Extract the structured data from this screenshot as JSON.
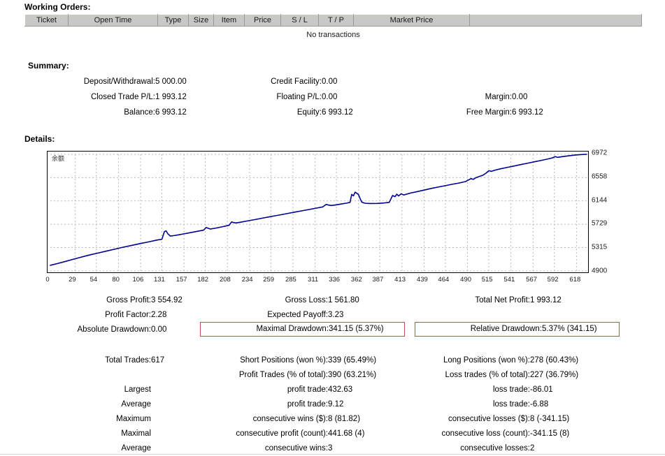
{
  "working_orders": {
    "title": "Working Orders:",
    "columns": [
      "Ticket",
      "Open Time",
      "Type",
      "Size",
      "Item",
      "Price",
      "S / L",
      "T / P",
      "Market Price",
      ""
    ],
    "empty_message": "No transactions"
  },
  "summary": {
    "title": "Summary:",
    "rows": [
      {
        "c1_label": "Deposit/Withdrawal:",
        "c1_value": "5 000.00",
        "c2_label": "Credit Facility:",
        "c2_value": "0.00",
        "c3_label": "",
        "c3_value": ""
      },
      {
        "c1_label": "Closed Trade P/L:",
        "c1_value": "1 993.12",
        "c2_label": "Floating P/L:",
        "c2_value": "0.00",
        "c3_label": "Margin:",
        "c3_value": "0.00"
      },
      {
        "c1_label": "Balance:",
        "c1_value": "6 993.12",
        "c2_label": "Equity:",
        "c2_value": "6 993.12",
        "c3_label": "Free Margin:",
        "c3_value": "6 993.12"
      }
    ]
  },
  "details": {
    "title": "Details:"
  },
  "stats_block_a": {
    "rows": [
      {
        "c1_label": "Gross Profit:",
        "c1_value": "3 554.92",
        "c2_label": "Gross Loss:",
        "c2_value": "1 561.80",
        "c3_label": "Total Net Profit:",
        "c3_value": "1 993.12",
        "c2_boxed": false,
        "c3_boxed": false
      },
      {
        "c1_label": "Profit Factor:",
        "c1_value": "2.28",
        "c2_label": "Expected Payoff:",
        "c2_value": "3.23",
        "c3_label": "",
        "c3_value": "",
        "c2_boxed": false,
        "c3_boxed": false
      },
      {
        "c1_label": "Absolute Drawdown:",
        "c1_value": "0.00",
        "c2_label": "Maximal Drawdown:",
        "c2_value": "341.15 (5.37%)",
        "c3_label": "Relative Drawdown:",
        "c3_value": "5.37% (341.15)",
        "c2_boxed": true,
        "c3_boxed": true
      }
    ]
  },
  "stats_block_b": {
    "rows": [
      {
        "c1_label": "Total Trades:",
        "c1_value": "617",
        "c2_label": "Short Positions (won %):",
        "c2_value": "339 (65.49%)",
        "c3_label": "Long Positions (won %):",
        "c3_value": "278 (60.43%)"
      },
      {
        "c1_label": "",
        "c1_value": "",
        "c2_label": "Profit Trades (% of total):",
        "c2_value": "390 (63.21%)",
        "c3_label": "Loss trades (% of total):",
        "c3_value": "227 (36.79%)"
      },
      {
        "c1_label": "Largest",
        "c1_value": "",
        "c2_label": "profit trade:",
        "c2_value": "432.63",
        "c3_label": "loss trade:",
        "c3_value": "-86.01"
      },
      {
        "c1_label": "Average",
        "c1_value": "",
        "c2_label": "profit trade:",
        "c2_value": "9.12",
        "c3_label": "loss trade:",
        "c3_value": "-6.88"
      },
      {
        "c1_label": "Maximum",
        "c1_value": "",
        "c2_label": "consecutive wins ($):",
        "c2_value": "8 (81.82)",
        "c3_label": "consecutive losses ($):",
        "c3_value": "8 (-341.15)"
      },
      {
        "c1_label": "Maximal",
        "c1_value": "",
        "c2_label": "consecutive profit (count):",
        "c2_value": "441.68 (4)",
        "c3_label": "consecutive loss (count):",
        "c3_value": "-341.15 (8)"
      },
      {
        "c1_label": "Average",
        "c1_value": "",
        "c2_label": "consecutive wins:",
        "c2_value": "3",
        "c3_label": "consecutive losses:",
        "c3_value": "2"
      }
    ]
  },
  "chart_data": {
    "type": "line",
    "title": "",
    "legend": "余额",
    "legend_position": "top-left",
    "line_color": "#00008f",
    "grid": true,
    "xlabel": "",
    "ylabel": "",
    "xlim": [
      0,
      630
    ],
    "ylim": [
      4900,
      6972
    ],
    "x_ticks": [
      0,
      29,
      54,
      80,
      106,
      131,
      157,
      182,
      208,
      234,
      259,
      285,
      311,
      336,
      362,
      387,
      413,
      439,
      464,
      490,
      515,
      541,
      567,
      592,
      618
    ],
    "y_ticks": [
      4900,
      5315,
      5729,
      6144,
      6558,
      6972
    ],
    "series": [
      {
        "name": "余额",
        "x": [
          0,
          8,
          16,
          25,
          35,
          45,
          55,
          65,
          75,
          85,
          95,
          105,
          115,
          125,
          131,
          134,
          136,
          138,
          141,
          145,
          150,
          158,
          166,
          174,
          180,
          183,
          185,
          188,
          194,
          202,
          210,
          213,
          215,
          218,
          224,
          232,
          240,
          248,
          256,
          264,
          272,
          280,
          288,
          296,
          304,
          312,
          320,
          324,
          327,
          330,
          336,
          342,
          348,
          352,
          354,
          356,
          358,
          360,
          362,
          364,
          366,
          370,
          376,
          384,
          392,
          398,
          402,
          405,
          407,
          409,
          412,
          415,
          418,
          421,
          424,
          428,
          434,
          440,
          448,
          456,
          464,
          472,
          480,
          488,
          494,
          497,
          500,
          504,
          508,
          512,
          515,
          518,
          522,
          528,
          536,
          544,
          552,
          560,
          568,
          576,
          584,
          590,
          593,
          596,
          602,
          610,
          618,
          626,
          630
        ],
        "y": [
          5000,
          5030,
          5062,
          5100,
          5140,
          5180,
          5215,
          5250,
          5285,
          5320,
          5352,
          5385,
          5415,
          5448,
          5462,
          5600,
          5612,
          5560,
          5520,
          5528,
          5540,
          5562,
          5585,
          5608,
          5625,
          5672,
          5660,
          5645,
          5660,
          5685,
          5712,
          5772,
          5760,
          5752,
          5768,
          5790,
          5812,
          5835,
          5858,
          5880,
          5902,
          5925,
          5948,
          5970,
          5992,
          6015,
          6038,
          6082,
          6070,
          6062,
          6075,
          6090,
          6105,
          6118,
          6260,
          6235,
          6300,
          6280,
          6255,
          6180,
          6120,
          6102,
          6098,
          6100,
          6108,
          6118,
          6240,
          6220,
          6265,
          6232,
          6270,
          6250,
          6262,
          6275,
          6288,
          6300,
          6320,
          6340,
          6368,
          6392,
          6415,
          6440,
          6462,
          6490,
          6540,
          6528,
          6558,
          6580,
          6600,
          6640,
          6680,
          6670,
          6690,
          6712,
          6738,
          6762,
          6788,
          6812,
          6838,
          6862,
          6888,
          6910,
          6932,
          6918,
          6932,
          6948,
          6962,
          6970,
          6972
        ]
      }
    ]
  }
}
